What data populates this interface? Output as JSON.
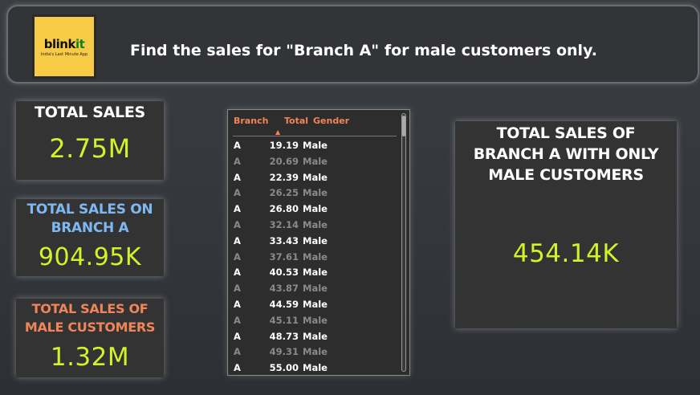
{
  "header": {
    "logo_text_main": "blink",
    "logo_text_accent": "it",
    "logo_tagline": "India's Last Minute App",
    "question": "Find the sales for \"Branch A\" for male customers only."
  },
  "cards": {
    "total_sales": {
      "title": "TOTAL SALES",
      "value": "2.75M"
    },
    "branch_a": {
      "title_line1": "TOTAL SALES ON",
      "title_line2": "BRANCH A",
      "value": "904.95K"
    },
    "male_customers": {
      "title_line1": "TOTAL SALES OF",
      "title_line2": "MALE CUSTOMERS",
      "value": "1.32M"
    },
    "branch_a_male": {
      "title_line1": "TOTAL SALES OF",
      "title_line2": "BRANCH A WITH ONLY",
      "title_line3": "MALE CUSTOMERS",
      "value": "454.14K"
    }
  },
  "table": {
    "columns": [
      "Branch",
      "Total",
      "Gender"
    ],
    "sort_icon": "sort-ascending-icon",
    "rows": [
      [
        "A",
        "19.19",
        "Male"
      ],
      [
        "A",
        "20.69",
        "Male"
      ],
      [
        "A",
        "22.39",
        "Male"
      ],
      [
        "A",
        "26.25",
        "Male"
      ],
      [
        "A",
        "26.80",
        "Male"
      ],
      [
        "A",
        "32.14",
        "Male"
      ],
      [
        "A",
        "33.43",
        "Male"
      ],
      [
        "A",
        "37.61",
        "Male"
      ],
      [
        "A",
        "40.53",
        "Male"
      ],
      [
        "A",
        "43.87",
        "Male"
      ],
      [
        "A",
        "44.59",
        "Male"
      ],
      [
        "A",
        "45.11",
        "Male"
      ],
      [
        "A",
        "48.73",
        "Male"
      ],
      [
        "A",
        "49.31",
        "Male"
      ],
      [
        "A",
        "55.00",
        "Male"
      ]
    ]
  },
  "colors": {
    "value_green": "#d4f22a",
    "title_blue": "#7fb8f0",
    "title_orange": "#f0855a",
    "logo_yellow": "#f8cb46"
  }
}
